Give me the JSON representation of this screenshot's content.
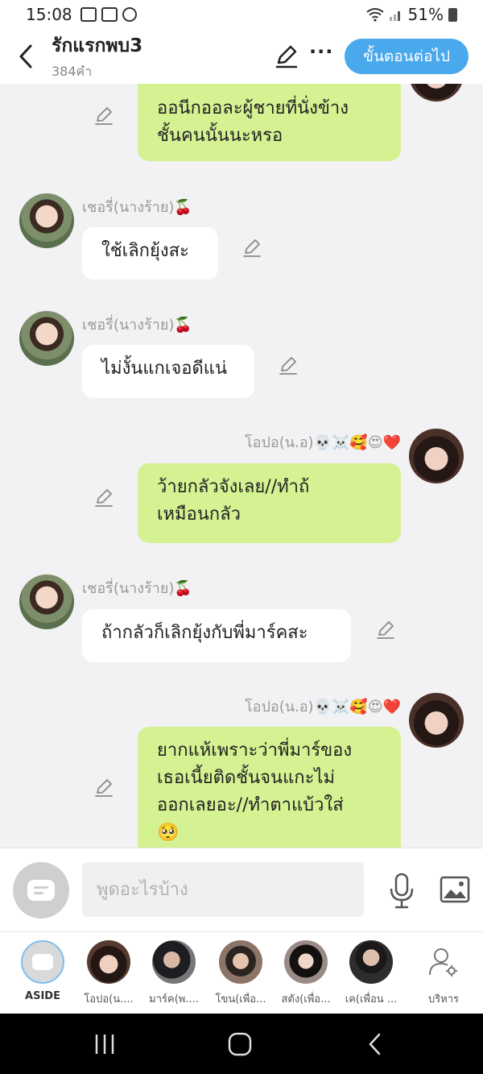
{
  "status_bar": {
    "time": "15:08",
    "battery": "51%",
    "icons": [
      "image-icon",
      "camera-icon",
      "line-icon",
      "wifi-icon",
      "signal-icon",
      "battery-icon"
    ]
  },
  "header": {
    "title": "รักแรกพบ3",
    "subtitle": "384คำ",
    "more_label": "···",
    "next_label": "ขั้นตอนต่อไป"
  },
  "messages": [
    {
      "side": "out",
      "lines": [
        "ออนีกออละผู้ชายที่นั่งข้าง",
        "ชั้นคนนั้นนะหรอ"
      ]
    },
    {
      "side": "in",
      "sender": "เชอรี่(นางร้าย)🍒",
      "text": "ใช้เลิกยุ้งสะ"
    },
    {
      "side": "in",
      "sender": "เชอรี่(นางร้าย)🍒",
      "text": "ไม่งั้นแกเจอดีแน่"
    },
    {
      "side": "out",
      "sender": "โอปอ(น.อ)💀☠️🥰😍❤️",
      "lines": [
        "ว้ายกลัวจังเลย//ทำถ้",
        "เหมือนกลัว"
      ]
    },
    {
      "side": "in",
      "sender": "เชอรี่(นางร้าย)🍒",
      "text": "ถ้ากลัวก็เลิกยุ้งกับพี่มาร์คสะ"
    },
    {
      "side": "out",
      "sender": "โอปอ(น.อ)💀☠️🥰😍❤️",
      "lines": [
        "ยากแห้เพราะว่าพี่มาร์ของ",
        "เธอเนี้ยติดชั้นจนแกะไม่",
        "ออกเลยอะ//ทำตาแบ้วใส่",
        "🥺"
      ]
    }
  ],
  "composer": {
    "placeholder": "พูดอะไรบ้าง"
  },
  "characters": [
    {
      "label": "ASIDE"
    },
    {
      "label": "โอปอ(น...."
    },
    {
      "label": "มาร์ค(พ...."
    },
    {
      "label": "โขน(เพื่อ..."
    },
    {
      "label": "สตัง(เพื่อ..."
    },
    {
      "label": "เค(เพื่อน ..."
    },
    {
      "label": "บริหาร"
    }
  ],
  "colors": {
    "accent": "#4aa8ec",
    "outgoing_bubble": "#d4f292",
    "incoming_bubble": "#ffffff",
    "chat_background": "#f2f2f4"
  }
}
